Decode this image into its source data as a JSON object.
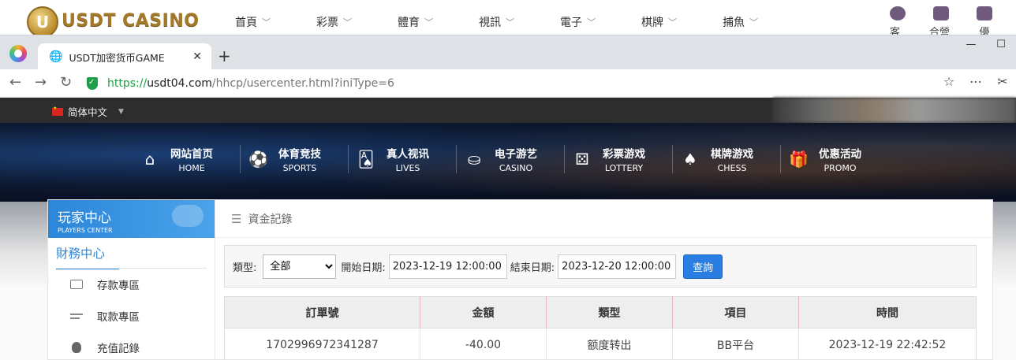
{
  "site": {
    "logo_text": "USDT CASINO",
    "logo_coin": "U",
    "nav": [
      "首頁",
      "彩票",
      "體育",
      "視訊",
      "電子",
      "棋牌",
      "捕魚"
    ],
    "right_links": [
      "客服",
      "合營夥伴",
      "優"
    ]
  },
  "browser": {
    "tab_title": "USDT加密货币GAME",
    "url_scheme": "https://",
    "url_host": "usdt04.com",
    "url_path": "/hhcp/usercenter.html?iniType=6"
  },
  "page": {
    "language": "简体中文",
    "main_nav": [
      {
        "cn": "网站首页",
        "en": "HOME",
        "icon": "home-icon",
        "glyph": "⌂"
      },
      {
        "cn": "体育竞技",
        "en": "SPORTS",
        "icon": "ball-icon",
        "glyph": "⚽"
      },
      {
        "cn": "真人视讯",
        "en": "LIVES",
        "icon": "cards-icon",
        "glyph": "🂡"
      },
      {
        "cn": "电子游艺",
        "en": "CASINO",
        "icon": "slot-icon",
        "glyph": "⛀"
      },
      {
        "cn": "彩票游戏",
        "en": "LOTTERY",
        "icon": "dice-icon",
        "glyph": "⚄"
      },
      {
        "cn": "棋牌游戏",
        "en": "CHESS",
        "icon": "spade-icon",
        "glyph": "♠"
      },
      {
        "cn": "优惠活动",
        "en": "PROMO",
        "icon": "gift-icon",
        "glyph": "🎁"
      }
    ],
    "sidebar": {
      "title_cn": "玩家中心",
      "title_en": "PLAYERS CENTER",
      "section": "財務中心",
      "items": [
        "存款專區",
        "取款專區",
        "充值記錄"
      ]
    },
    "panel": {
      "title": "資金記錄",
      "filter": {
        "type_label": "類型:",
        "type_value": "全部",
        "start_label": "開始日期:",
        "start_value": "2023-12-19 12:00:00",
        "end_label": "結束日期:",
        "end_value": "2023-12-20 12:00:00",
        "search_label": "查詢"
      },
      "table": {
        "headers": [
          "訂單號",
          "金額",
          "類型",
          "項目",
          "時間"
        ],
        "rows": [
          [
            "1702996972341287",
            "-40.00",
            "额度转出",
            "BB平台",
            "2023-12-19 22:42:52"
          ]
        ]
      }
    }
  }
}
